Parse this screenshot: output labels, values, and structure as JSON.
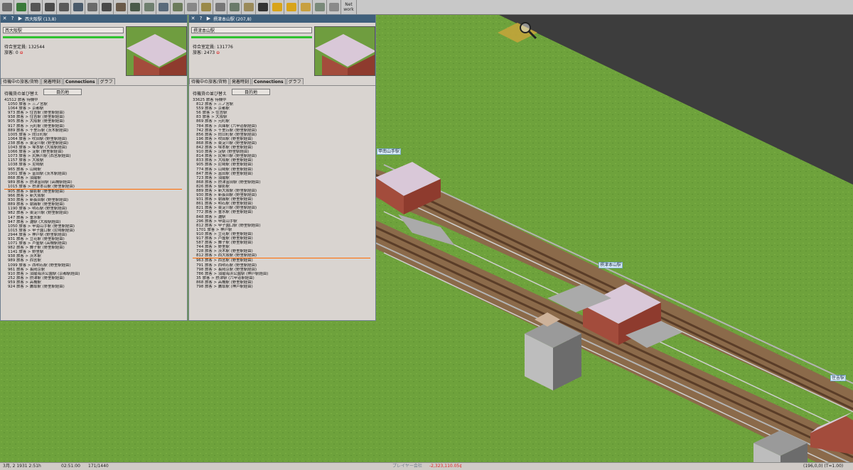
{
  "toolbar": {
    "icons": [
      "disk-icon",
      "map-icon",
      "magnifier-icon",
      "rail-tool-icon",
      "road-tool-icon",
      "monorail-tool-icon",
      "tram-tool-icon",
      "airport-tool-icon",
      "maglev-tool-icon",
      "narrowgauge-tool-icon",
      "powerline-tool-icon",
      "ship-tool-icon",
      "terraform-tool-icon",
      "depot-icon",
      "schedule-icon",
      "list-icon",
      "chart-icon",
      "finance-icon",
      "camera-icon",
      "pause-icon",
      "fastforward-icon",
      "help-icon",
      "marker-icon",
      "grid-icon"
    ],
    "network_label": "Net\nwork"
  },
  "windows": [
    {
      "title": "西大阪駅 (13,8)",
      "name": "西大阪駅",
      "capacity_label": "待合室定員: 132544",
      "waiting_label": "旅客: 0",
      "tabs": [
        "待機中の旅客/貨物",
        "発着時刻",
        "Connections",
        "グラフ"
      ],
      "sort_label": "待機貨の並び替え",
      "sort_button": "目的地",
      "rows": [
        {
          "text": "41512 旅客 待機中",
          "indent": false
        },
        {
          "text": "1050 旅客 > 三ノ宮駅",
          "indent": true
        },
        {
          "text": "1064 旅客 > 京都駅",
          "indent": true
        },
        {
          "text": "973 旅客 > 住吉駅 (野里駅経由)",
          "indent": true
        },
        {
          "text": "938 旅客 > 住吉駅 (野里駅経由)",
          "indent": true
        },
        {
          "text": "905 旅客 > 大阪駅 (野里駅経由)",
          "indent": true
        },
        {
          "text": "917 旅客 > 元町駅 (野里駅経由)",
          "indent": true
        },
        {
          "text": "889 旅客 > 千里丘駅 (茨木駅経由)",
          "indent": true
        },
        {
          "text": "1005 旅客 > 向日町駅",
          "indent": true
        },
        {
          "text": "1064 旅客 > 吹田駅 (野里駅経由)",
          "indent": true
        },
        {
          "text": "238 旅客 > 東淀川駅 (野里駅経由)",
          "indent": true
        },
        {
          "text": "1043 旅客 > 塚本駅 (大阪駅経由)",
          "indent": true
        },
        {
          "text": "1066 旅客 > 淀駅 (野里駅経由)",
          "indent": true
        },
        {
          "text": "1073 旅客 > 尻無川駅 (西宮駅経由)",
          "indent": true
        },
        {
          "text": "1157 旅客 > 大阪駅",
          "indent": true
        },
        {
          "text": "1038 旅客 > 尼崎駅",
          "indent": true
        },
        {
          "text": "965 旅客 > 山崎駅",
          "indent": true
        },
        {
          "text": "1001 旅客 > 富田駅 (茨木駅経由)",
          "indent": true
        },
        {
          "text": "868 旅客 > 須磨駅",
          "indent": true
        },
        {
          "text": "989 旅客 > 摂津富田駅 (高槻駅経由)",
          "indent": true
        },
        {
          "text": "1015 旅客 > 摂津本山駅 (野里駅経由)",
          "indent": true,
          "hl": true
        },
        {
          "text": "905 旅客 > 御影駅 (野里駅経由)",
          "indent": true
        },
        {
          "text": "966 旅客 > 新大阪駅",
          "indent": true
        },
        {
          "text": "930 旅客 > 新長田駅 (野里駅経由)",
          "indent": true
        },
        {
          "text": "889 旅客 > 朝霧駅 (野里駅経由)",
          "indent": true
        },
        {
          "text": "1190 旅客 > 明石駅 (野里駅経由)",
          "indent": true
        },
        {
          "text": "982 旅客 > 東淀川駅 (野里駅経由)",
          "indent": true
        },
        {
          "text": "147 旅客 > 垂水駅",
          "indent": true
        },
        {
          "text": "947 旅客 > 灘駅 (大阪駅経由)",
          "indent": true
        },
        {
          "text": "1050 旅客 > 甲南山手駅 (野里駅経由)",
          "indent": true
        },
        {
          "text": "1015 旅客 > 甲子園口駅 (尼崎駅経由)",
          "indent": true
        },
        {
          "text": "2944 旅客 > 神戸駅 (野里駅経由)",
          "indent": true
        },
        {
          "text": "931 旅客 > 立花駅 (野里駅経由)",
          "indent": true
        },
        {
          "text": "1071 旅客 > 芦屋駅 (高槻駅経由)",
          "indent": true
        },
        {
          "text": "982 旅客 > 舞子駅 (野里駅経由)",
          "indent": true
        },
        {
          "text": "1141 旅客 > 野里駅",
          "indent": true
        },
        {
          "text": "938 旅客 > 茨木駅",
          "indent": true
        },
        {
          "text": "989 旅客 > 西宮駅",
          "indent": true
        },
        {
          "text": "1099 旅客 > 西明石駅 (野里駅経由)",
          "indent": true
        },
        {
          "text": "961 旅客 > 長岡京駅",
          "indent": true
        },
        {
          "text": "910 旅客 > 須磨海浜公園駅 (京都駅経由)",
          "indent": true
        },
        {
          "text": "252 旅客 > 摂津駅 (野里駅経由)",
          "indent": true
        },
        {
          "text": "959 旅客 > 高槻駅",
          "indent": true
        },
        {
          "text": "924 旅客 > 鷹取駅 (野里駅経由)",
          "indent": true
        }
      ]
    },
    {
      "title": "摂津本山駅 (207,8)",
      "name": "摂津本山駅",
      "capacity_label": "待合室定員: 131776",
      "waiting_label": "旅客: 2473",
      "tabs": [
        "待機中の旅客/貨物",
        "発着時刻",
        "Connections",
        "グラフ"
      ],
      "sort_label": "待機貨の並び替え",
      "sort_button": "目的地",
      "rows": [
        {
          "text": "33625 旅客 待機中",
          "indent": false
        },
        {
          "text": "812 旅客 > 三ノ宮駅",
          "indent": true
        },
        {
          "text": "559 旅客 > 京都駅",
          "indent": true
        },
        {
          "text": "56 旅客 > 住吉駅",
          "indent": true
        },
        {
          "text": "83 旅客 > 大阪駅",
          "indent": true
        },
        {
          "text": "869 旅客 > 元町駅",
          "indent": true
        },
        {
          "text": "784 旅客 > 兵庫駅 (六甲道駅経由)",
          "indent": true
        },
        {
          "text": "742 旅客 > 千里丘駅 (野里駅経由)",
          "indent": true
        },
        {
          "text": "856 旅客 > 向日町駅 (野里駅経由)",
          "indent": true
        },
        {
          "text": "196 旅客 > 吹田駅 (野里駅経由)",
          "indent": true
        },
        {
          "text": "868 旅客 > 東淀川駅 (野里駅経由)",
          "indent": true
        },
        {
          "text": "842 旅客 > 塚本駅 (野里駅経由)",
          "indent": true
        },
        {
          "text": "910 旅客 > 淀駅 (野里駅経由)",
          "indent": true
        },
        {
          "text": "814 旅客 > 尻無川駅 (野里駅経由)",
          "indent": true
        },
        {
          "text": "833 旅客 > 大阪駅 (野里駅経由)",
          "indent": true
        },
        {
          "text": "905 旅客 > 尼崎駅 (野里駅経由)",
          "indent": true
        },
        {
          "text": "774 旅客 > 山崎駅 (野里駅経由)",
          "indent": true
        },
        {
          "text": "847 旅客 > 富田駅 (野里駅経由)",
          "indent": true
        },
        {
          "text": "723 旅客 > 須磨駅",
          "indent": true
        },
        {
          "text": "868 旅客 > 摂津富田駅 (野里駅経由)",
          "indent": true
        },
        {
          "text": "826 旅客 > 御影駅",
          "indent": true
        },
        {
          "text": "889 旅客 > 新大阪駅 (野里駅経由)",
          "indent": true
        },
        {
          "text": "930 旅客 > 新長田駅 (野里駅経由)",
          "indent": true
        },
        {
          "text": "931 旅客 > 朝霧駅 (野里駅経由)",
          "indent": true
        },
        {
          "text": "861 旅客 > 明石駅 (野里駅経由)",
          "indent": true
        },
        {
          "text": "821 旅客 > 東淀川駅 (野里駅経由)",
          "indent": true
        },
        {
          "text": "772 旅客 > 垂水駅 (野里駅経由)",
          "indent": true
        },
        {
          "text": "848 旅客 > 灘駅",
          "indent": true
        },
        {
          "text": "296 旅客 > 甲南山手駅",
          "indent": true
        },
        {
          "text": "812 旅客 > 甲子園口駅 (野里駅経由)",
          "indent": true
        },
        {
          "text": "1701 旅客 > 神戸駅",
          "indent": true
        },
        {
          "text": "910 旅客 > 立花駅 (野里駅経由)",
          "indent": true
        },
        {
          "text": "917 旅客 > 芦屋駅 (野里駅経由)",
          "indent": true
        },
        {
          "text": "587 旅客 > 舞子駅 (野里駅経由)",
          "indent": true
        },
        {
          "text": "744 旅客 > 野里駅",
          "indent": true
        },
        {
          "text": "728 旅客 > 茨木駅 (野里駅経由)",
          "indent": true
        },
        {
          "text": "812 旅客 > 西大阪駅 (野里駅経由)",
          "indent": true,
          "hl": true
        },
        {
          "text": "963 旅客 > 西宮駅 (野里駅経由)",
          "indent": true
        },
        {
          "text": "791 旅客 > 西明石駅 (野里駅経由)",
          "indent": true
        },
        {
          "text": "798 旅客 > 長岡京駅 (野里駅経由)",
          "indent": true
        },
        {
          "text": "786 旅客 > 須磨海浜公園駅 (神戸駅経由)",
          "indent": true
        },
        {
          "text": "35 旅客 > 摂津駅 (六甲道駅経由)",
          "indent": true
        },
        {
          "text": "868 旅客 > 高槻駅 (野里駅経由)",
          "indent": true
        },
        {
          "text": "798 旅客 > 鷹取駅 (神戸駅経由)",
          "indent": true
        }
      ]
    }
  ],
  "map_labels": {
    "station_a": "甲南山手駅",
    "station_b": "摂津本山駅",
    "station_c": "住吉駅"
  },
  "status": {
    "date": "3月, 2 1931 2:51h",
    "clock": "02:51:00",
    "ratio": "171/1440",
    "company": "プレイヤー会社",
    "money": "-2,323,110.05¢",
    "coords": "(196,0,0) (T=1.00)"
  },
  "colors": {
    "titlebar": "#3f5f7b",
    "grass": "#6ea23c",
    "money_negative": "#e02020",
    "highlight_line": "#ff6a00",
    "progress_fill": "#2fc22f"
  }
}
